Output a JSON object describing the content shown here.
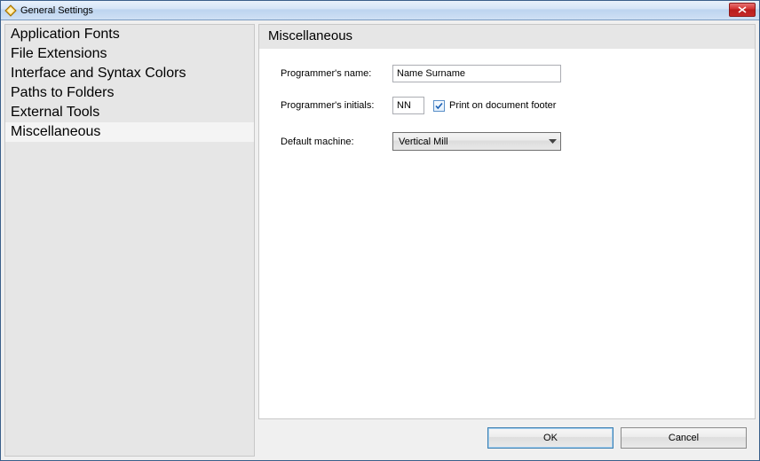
{
  "window": {
    "title": "General Settings"
  },
  "sidebar": {
    "items": [
      {
        "label": "Application Fonts",
        "selected": false
      },
      {
        "label": "File Extensions",
        "selected": false
      },
      {
        "label": "Interface and Syntax Colors",
        "selected": false
      },
      {
        "label": "Paths to Folders",
        "selected": false
      },
      {
        "label": "External Tools",
        "selected": false
      },
      {
        "label": "Miscellaneous",
        "selected": true
      }
    ]
  },
  "panel": {
    "heading": "Miscellaneous",
    "labels": {
      "programmer_name": "Programmer's name:",
      "programmer_initials": "Programmer's initials:",
      "print_footer": "Print on document footer",
      "default_machine": "Default machine:"
    },
    "values": {
      "programmer_name": "Name Surname",
      "programmer_initials": "NN",
      "print_footer_checked": true,
      "default_machine": "Vertical Mill"
    }
  },
  "footer": {
    "ok": "OK",
    "cancel": "Cancel"
  }
}
